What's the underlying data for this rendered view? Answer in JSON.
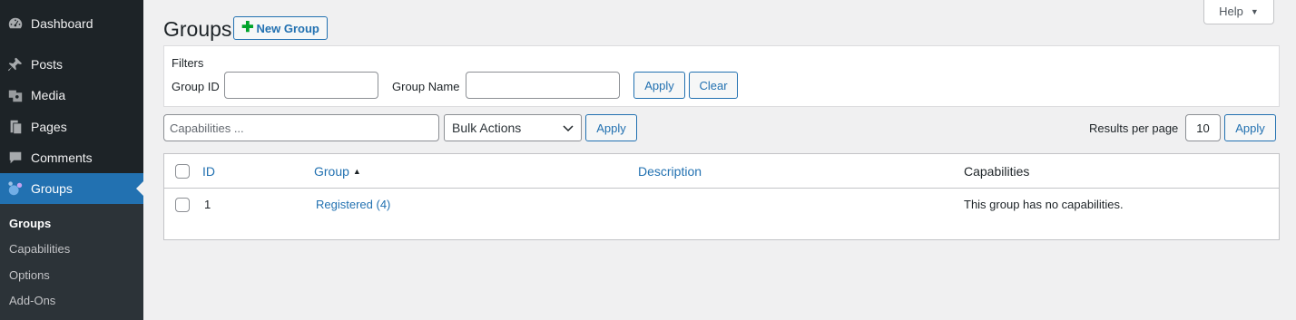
{
  "sidebar": {
    "items": [
      {
        "label": "Dashboard",
        "icon": "dashboard-icon"
      },
      {
        "label": "Posts",
        "icon": "pin-icon"
      },
      {
        "label": "Media",
        "icon": "media-icon"
      },
      {
        "label": "Pages",
        "icon": "pages-icon"
      },
      {
        "label": "Comments",
        "icon": "comment-icon"
      },
      {
        "label": "Groups",
        "icon": "groups-icon",
        "current": true
      }
    ],
    "submenu": [
      {
        "label": "Groups",
        "current": true
      },
      {
        "label": "Capabilities"
      },
      {
        "label": "Options"
      },
      {
        "label": "Add-Ons"
      }
    ]
  },
  "header": {
    "title": "Groups",
    "new_group_label": "New Group",
    "help_label": "Help"
  },
  "filters": {
    "title": "Filters",
    "group_id_label": "Group ID",
    "group_id_value": "",
    "group_name_label": "Group Name",
    "group_name_value": "",
    "apply_label": "Apply",
    "clear_label": "Clear"
  },
  "tablenav": {
    "capabilities_placeholder": "Capabilities ...",
    "bulk_actions_selected": "Bulk Actions",
    "apply_label": "Apply",
    "results_per_page_label": "Results per page",
    "results_per_page_value": "10",
    "results_apply_label": "Apply"
  },
  "table": {
    "columns": {
      "id": "ID",
      "group": "Group",
      "description": "Description",
      "capabilities": "Capabilities"
    },
    "rows": [
      {
        "id": "1",
        "group": "Registered",
        "count": "(4)",
        "description": "",
        "capabilities": "This group has no capabilities."
      }
    ]
  },
  "colors": {
    "accent": "#2271b1",
    "sidebar_bg": "#1d2327",
    "plus": "#00a32a"
  }
}
